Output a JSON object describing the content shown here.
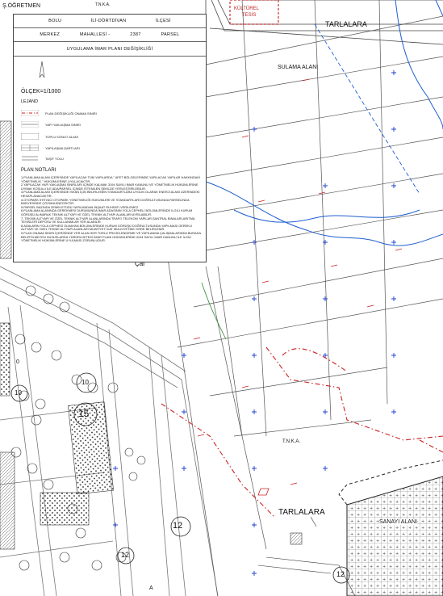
{
  "panel": {
    "row1": [
      "BOLU",
      "İLİ-DÖRTDİVAN",
      "İLÇESİ"
    ],
    "row2": [
      "MERKEZ",
      "MAHALLESİ -",
      "2387",
      "PARSEL"
    ],
    "row3": "UYGULAMA İMAR PLANI DEĞİŞİKLİĞİ",
    "scale": "ÖLÇEK=1/1000",
    "legend_title": "LEJAND",
    "legend": [
      {
        "label": "PLAN DEĞİŞİKLİĞİ ONAMA SINIRI",
        "icon": "dash-dot-line"
      },
      {
        "label": "YAPI YAKLAŞMA SINIRI",
        "icon": "thin-line"
      },
      {
        "label": "TOPLU KONUT ALANI",
        "icon": "rectangle"
      },
      {
        "label": "YAPILAŞMA ŞARTLARI",
        "icon": "table-box"
      },
      {
        "label": "TAŞIT YOLU",
        "icon": "double-line"
      }
    ],
    "notes_title": "PLAN NOTLARI",
    "notes": [
      "1.PLANLAMA ALANI İÇERİSİNDE YAPILACAK TÜM YAPILARDA \" AFET BÖLGELERİNDE YAPILACAK YAPILAR HAKKINDAKİ YÖNETMELİK \" HÜKÜMLERİNE UYULACAKTIR.",
      "2.YAPILACAK YAPI YAKLAŞMA SINIRLARI İÇİNDE KALMAK 3194 SAYILI İMAR KANUNU VE YÖNETMELİK HÜKÜMLERİNE UYMAK KOŞULU İLE ADA/PARSEL İÇİNDE İSTENİLEN ŞEKİLDE YERLEŞTİRİLEBİLİR.",
      "3.PLANLAMA ALANI İÇERİSİNDE İSKÂN İÇİN BELİRLENEN STANDARTLARA UYGUN OLARAK ENERJİ ALANI ÜZERİNDEKİ HESAPLANACAKTIR.",
      "4.OTOPARK İHTİYACI OTOPARK YÖNETMELİĞİ HÜKÜMLERİ VE STANDARTLARI DOĞRULTUSUNDA PARSELİNDA BÜNYESİNDE ÇÖZÜMLENECEKTİR.",
      "5.PARSEL BAZINDA ZEMİN ETÜDÜ YAPILMADAN İNŞAAT RUHSATI VERİLEMEZ.",
      "6.PLANLAMA ALANINDA GEREKMESİ DURUMUNDA İMAR ADASININ YOLA CEPHELİ BÖLÜMLERİNDE İLGİLİ KURUM GÖRÜŞÜ ALINARAK TEKNİK ALTYAPI VE ÖZEL TEKNİK ALTYAPI ALANLARI AYRILABİLİR.",
      "7. TEKNİK ALTYAPI VE ÖZEL TEKNİK ALTYAPI ALANLARINDA TRAFO TELEKOM YAPILAR,SANTRAL BİNALARI,ARITMA TESİSLERİ DEPOSU VE KULLANIMLAR YER ALABİLİR.",
      "8.ADALARIN YOLA CEPHESİ OLMAYAN BÖLÜMLERİNDE KURUM GÖRÜŞÜ DOĞRULTUSUNDA YAPILMASI GEREKLİ ALTYAPI VE ÖZEL TEKNİK ALTYAPI ALANLARI MUAFİYETİ KAT MÜLKİYETİNE GÖRE BELİRLENİR.",
      "9.PLAN ONAMA SINIRI İÇERİSİNDE YER ALAN HER TÜRLÜ PROJELENDİRME VE YAPILANMA ÇALIŞMALARINDA BURADA BELİRTİLMEYEN HUSUSLARDA YÜRÜRLÜKTEKİ İMAR PLANI HÜKÜMLERİNE,3194 SAYILI İMAR KANUNU İLE İLGİLİ YÖNETMELİK HÜKÜMLERİNE UYULMASI ZORUNLUDUR."
    ]
  },
  "map_labels": {
    "top_left": "Ş.ÖĞRETMEN",
    "tnka_top": "T.N.K.A.",
    "kulturel": "KÜLTÜREL",
    "tesis": "TESİS",
    "tarlalara_top": "TARLALARA",
    "sulama": "SULAMA ALANI",
    "cal": "Çal",
    "tnka_mid": "T.N.K.A.",
    "tarlalara_bottom": "TARLALARA",
    "sanayi": "SANAYİ ALANI",
    "num_10a": "10",
    "num_10b": "10",
    "num_15": "15",
    "num_12a": "12",
    "num_12b": "12",
    "num_12c": "12",
    "num_a": "A",
    "num_0": "0"
  }
}
